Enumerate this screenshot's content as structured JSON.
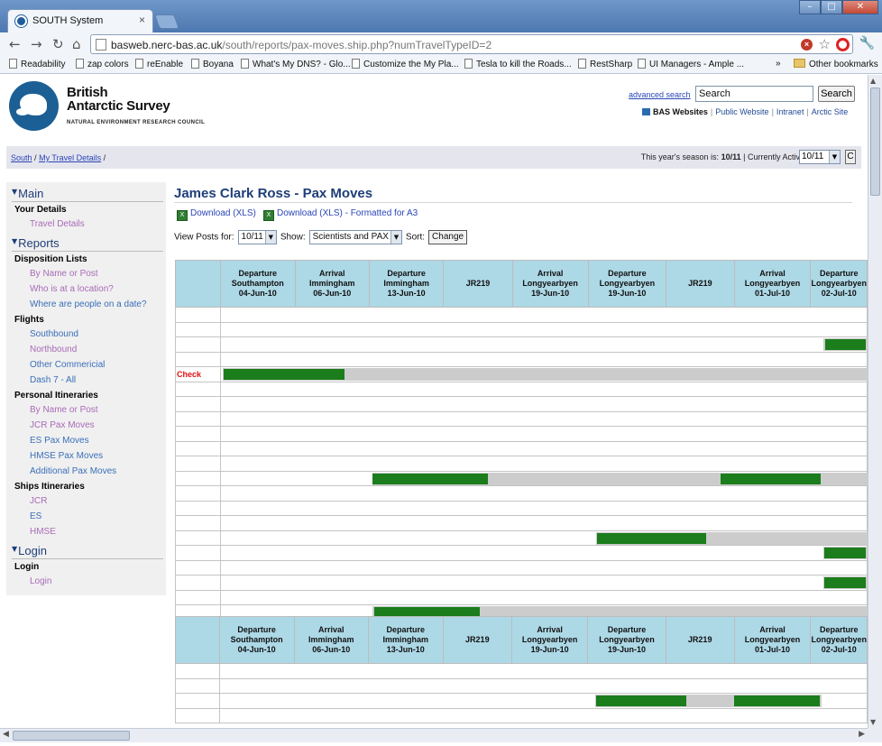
{
  "browser": {
    "tab_title": "SOUTH System",
    "url_host": "basweb.nerc-bas.ac.uk",
    "url_path": "/south/reports/pax-moves.ship.php?numTravelTypeID=2",
    "bookmarks": [
      "Readability",
      "zap colors",
      "reEnable",
      "Boyana",
      "What's My DNS? - Glo...",
      "Customize the My Pla...",
      "Tesla to kill the Roads...",
      "RestSharp",
      "UI Managers - Ample ..."
    ],
    "bookmarks_more": "»",
    "other_bookmarks": "Other bookmarks"
  },
  "header": {
    "org_line1": "British",
    "org_line2": "Antarctic Survey",
    "org_sub": "NATURAL ENVIRONMENT RESEARCH COUNCIL",
    "advanced_search": "advanced search",
    "search_value": "Search",
    "search_button": "Search",
    "bas_websites": "BAS Websites",
    "links": [
      "Public Website",
      "Intranet",
      "Arctic Site"
    ]
  },
  "breadcrumb": {
    "root": "South",
    "current": "My Travel Details",
    "sep": "/",
    "season_label": "This year's season is:",
    "season_value": "10/11",
    "active_year_label": "Currently Active Year:",
    "active_year_value": "10/11",
    "c_button": "C"
  },
  "sidebar": {
    "main_head": "Main",
    "your_details": "Your Details",
    "travel_details": "Travel Details",
    "reports_head": "Reports",
    "disposition_lists": "Disposition Lists",
    "disp_items": [
      "By Name or Post",
      "Who is at a location?",
      "Where are people on a date?"
    ],
    "flights": "Flights",
    "flight_items": [
      "Southbound",
      "Northbound",
      "Other Commericial",
      "Dash 7 - All"
    ],
    "personal_itin": "Personal Itineraries",
    "personal_items": [
      "By Name or Post",
      "JCR Pax Moves",
      "ES Pax Moves",
      "HMSE Pax Moves",
      "Additional Pax Moves"
    ],
    "ships_itin": "Ships Itineraries",
    "ship_items": [
      "JCR",
      "ES",
      "HMSE"
    ],
    "login_head": "Login",
    "login_group": "Login",
    "login_link": "Login"
  },
  "main": {
    "title": "James Clark Ross - Pax Moves",
    "download1": "Download (XLS)",
    "download2": "Download (XLS) - Formatted for A3",
    "view_posts_label": "View Posts for:",
    "view_posts_value": "10/11",
    "show_label": "Show:",
    "show_value": "Scientists and PAX",
    "sort_label": "Sort:",
    "change_button": "Change",
    "columns": [
      {
        "l1": "Departure",
        "l2": "Southampton",
        "l3": "04-Jun-10"
      },
      {
        "l1": "Arrival",
        "l2": "Immingham",
        "l3": "06-Jun-10"
      },
      {
        "l1": "Departure",
        "l2": "Immingham",
        "l3": "13-Jun-10"
      },
      {
        "l1": "JR219",
        "l2": "",
        "l3": ""
      },
      {
        "l1": "Arrival",
        "l2": "Longyearbyen",
        "l3": "19-Jun-10"
      },
      {
        "l1": "Departure",
        "l2": "Longyearbyen",
        "l3": "19-Jun-10"
      },
      {
        "l1": "JR219",
        "l2": "",
        "l3": ""
      },
      {
        "l1": "Arrival",
        "l2": "Longyearbyen",
        "l3": "01-Jul-10"
      },
      {
        "l1": "Departure",
        "l2": "Longyearbyen",
        "l3": "02-Jul-10"
      }
    ],
    "check_label": "Check"
  }
}
